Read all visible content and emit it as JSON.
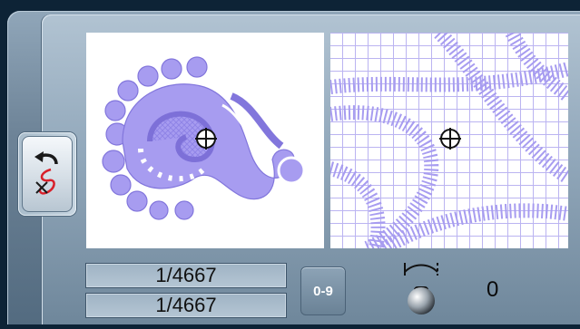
{
  "side_button": {
    "icon": "undo-stitch-icon"
  },
  "preview": {
    "left_panel": {
      "icon": "embroidery-design-icon",
      "cursor_icon": "crosshair-icon"
    },
    "right_panel": {
      "icon": "stitch-zoom-icon",
      "cursor_icon": "crosshair-icon"
    }
  },
  "counters": {
    "current": "1/4667",
    "total": "1/4667"
  },
  "numeric_button": {
    "label": "0-9"
  },
  "knob": {
    "icon": "stitch-knob-icon",
    "value": "0"
  },
  "colors": {
    "design": "#a79cf0",
    "panel_bg": "#ffffff",
    "frame": "#0d2336"
  }
}
